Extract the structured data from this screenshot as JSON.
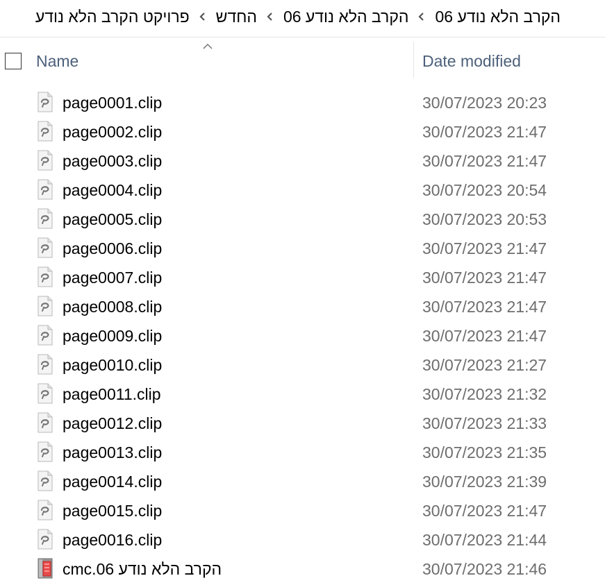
{
  "breadcrumb": {
    "items": [
      "הקרב הלא נודע 06",
      "הקרב הלא נודע 06",
      "החדש",
      "פרויקט הקרב הלא נודע"
    ],
    "separator_icon": "chevron-left-icon"
  },
  "columns": {
    "name_label": "Name",
    "date_label": "Date modified",
    "sort_icon": "sort-up-arrow-icon",
    "select_all_icon": "checkbox-icon"
  },
  "files": [
    {
      "name": "page0001.clip",
      "date": "30/07/2023 20:23",
      "icon": "clip-file-icon"
    },
    {
      "name": "page0002.clip",
      "date": "30/07/2023 21:47",
      "icon": "clip-file-icon"
    },
    {
      "name": "page0003.clip",
      "date": "30/07/2023 21:47",
      "icon": "clip-file-icon"
    },
    {
      "name": "page0004.clip",
      "date": "30/07/2023 20:54",
      "icon": "clip-file-icon"
    },
    {
      "name": "page0005.clip",
      "date": "30/07/2023 20:53",
      "icon": "clip-file-icon"
    },
    {
      "name": "page0006.clip",
      "date": "30/07/2023 21:47",
      "icon": "clip-file-icon"
    },
    {
      "name": "page0007.clip",
      "date": "30/07/2023 21:47",
      "icon": "clip-file-icon"
    },
    {
      "name": "page0008.clip",
      "date": "30/07/2023 21:47",
      "icon": "clip-file-icon"
    },
    {
      "name": "page0009.clip",
      "date": "30/07/2023 21:47",
      "icon": "clip-file-icon"
    },
    {
      "name": "page0010.clip",
      "date": "30/07/2023 21:27",
      "icon": "clip-file-icon"
    },
    {
      "name": "page0011.clip",
      "date": "30/07/2023 21:32",
      "icon": "clip-file-icon"
    },
    {
      "name": "page0012.clip",
      "date": "30/07/2023 21:33",
      "icon": "clip-file-icon"
    },
    {
      "name": "page0013.clip",
      "date": "30/07/2023 21:35",
      "icon": "clip-file-icon"
    },
    {
      "name": "page0014.clip",
      "date": "30/07/2023 21:39",
      "icon": "clip-file-icon"
    },
    {
      "name": "page0015.clip",
      "date": "30/07/2023 21:47",
      "icon": "clip-file-icon"
    },
    {
      "name": "page0016.clip",
      "date": "30/07/2023 21:44",
      "icon": "clip-file-icon"
    },
    {
      "name": "הקרב הלא נודע 06.cmc",
      "date": "30/07/2023 21:46",
      "icon": "cmc-file-icon"
    }
  ]
}
